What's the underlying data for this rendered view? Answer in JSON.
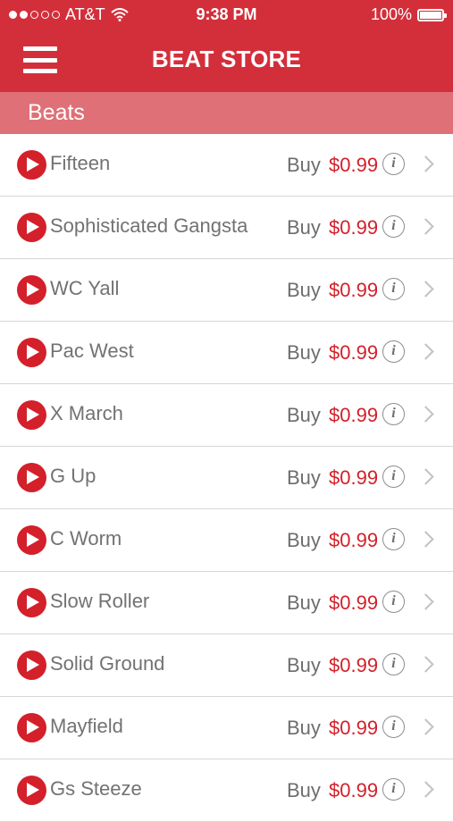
{
  "status_bar": {
    "carrier": "AT&T",
    "time": "9:38 PM",
    "battery": "100%",
    "signal_bars_filled": 2,
    "signal_bars_total": 5
  },
  "nav": {
    "title": "BEAT STORE",
    "menu_icon": "hamburger-menu-icon"
  },
  "section": {
    "title": "Beats"
  },
  "colors": {
    "brand_red": "#d32f3b",
    "section_bg": "#e07077",
    "price_red": "#d3202a"
  },
  "beats": [
    {
      "name": "Fifteen",
      "buy_label": "Buy",
      "price": "$0.99",
      "info": "i"
    },
    {
      "name": "Sophisticated Gangsta",
      "buy_label": "Buy",
      "price": "$0.99",
      "info": "i"
    },
    {
      "name": "WC Yall",
      "buy_label": "Buy",
      "price": "$0.99",
      "info": "i"
    },
    {
      "name": "Pac West",
      "buy_label": "Buy",
      "price": "$0.99",
      "info": "i"
    },
    {
      "name": "X March",
      "buy_label": "Buy",
      "price": "$0.99",
      "info": "i"
    },
    {
      "name": "G Up",
      "buy_label": "Buy",
      "price": "$0.99",
      "info": "i"
    },
    {
      "name": "C Worm",
      "buy_label": "Buy",
      "price": "$0.99",
      "info": "i"
    },
    {
      "name": "Slow Roller",
      "buy_label": "Buy",
      "price": "$0.99",
      "info": "i"
    },
    {
      "name": "Solid Ground",
      "buy_label": "Buy",
      "price": "$0.99",
      "info": "i"
    },
    {
      "name": "Mayfield",
      "buy_label": "Buy",
      "price": "$0.99",
      "info": "i"
    },
    {
      "name": "Gs Steeze",
      "buy_label": "Buy",
      "price": "$0.99",
      "info": "i"
    }
  ]
}
